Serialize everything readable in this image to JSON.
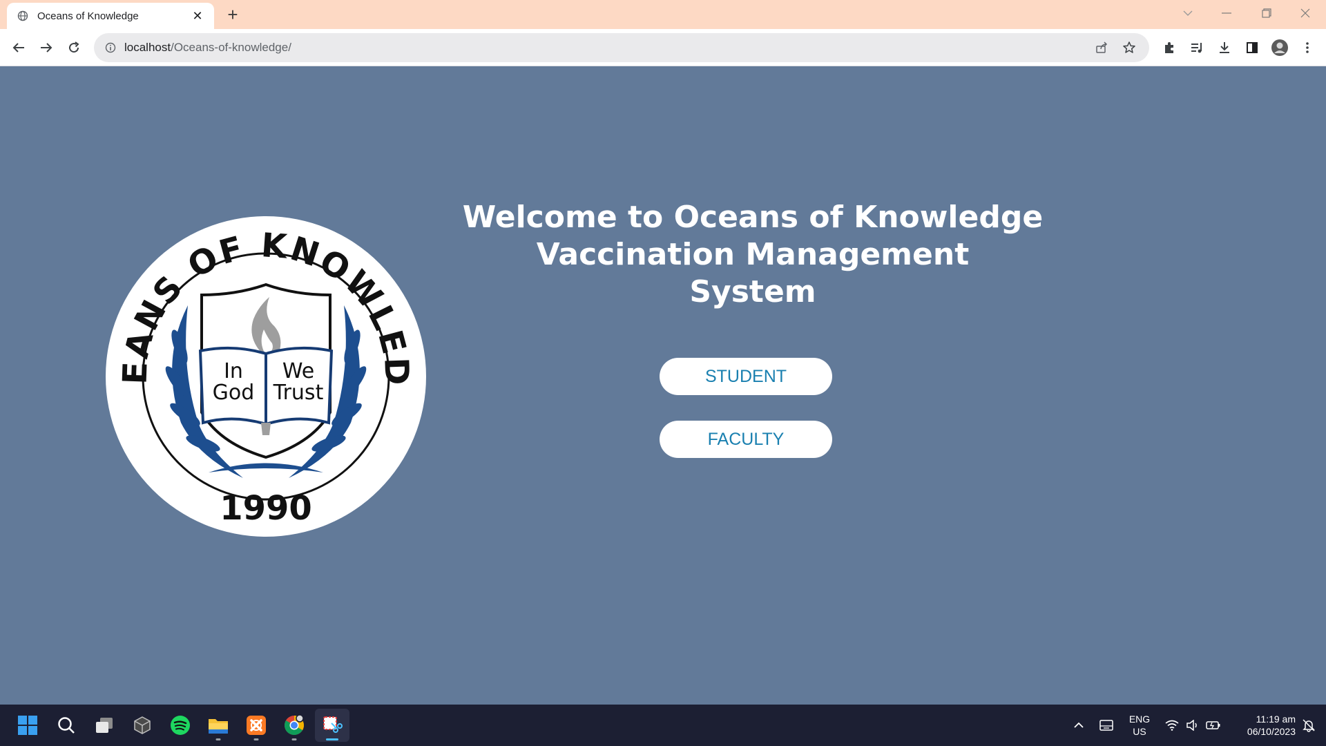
{
  "browser": {
    "tab": {
      "title": "Oceans of Knowledge",
      "close_label": "✕"
    },
    "new_tab_label": "+",
    "address": {
      "host": "localhost",
      "path": "/Oceans-of-knowledge/"
    }
  },
  "logo": {
    "ring_text": "OCEANS OF KNOWLEDGE",
    "year": "1990",
    "book_left_line1": "In",
    "book_left_line2": "God",
    "book_right_line1": "We",
    "book_right_line2": "Trust"
  },
  "page": {
    "heading_line1": "Welcome to Oceans of Knowledge",
    "heading_line2": "Vaccination Management",
    "heading_line3": "System",
    "student_button": "STUDENT",
    "faculty_button": "FACULTY"
  },
  "taskbar": {
    "language_line1": "ENG",
    "language_line2": "US",
    "time": "11:19 am",
    "date": "06/10/2023"
  },
  "colors": {
    "page_background": "#627a99",
    "button_text": "#1a80b0",
    "tabstrip": "#fdd9c4",
    "taskbar": "#1c1f33"
  }
}
